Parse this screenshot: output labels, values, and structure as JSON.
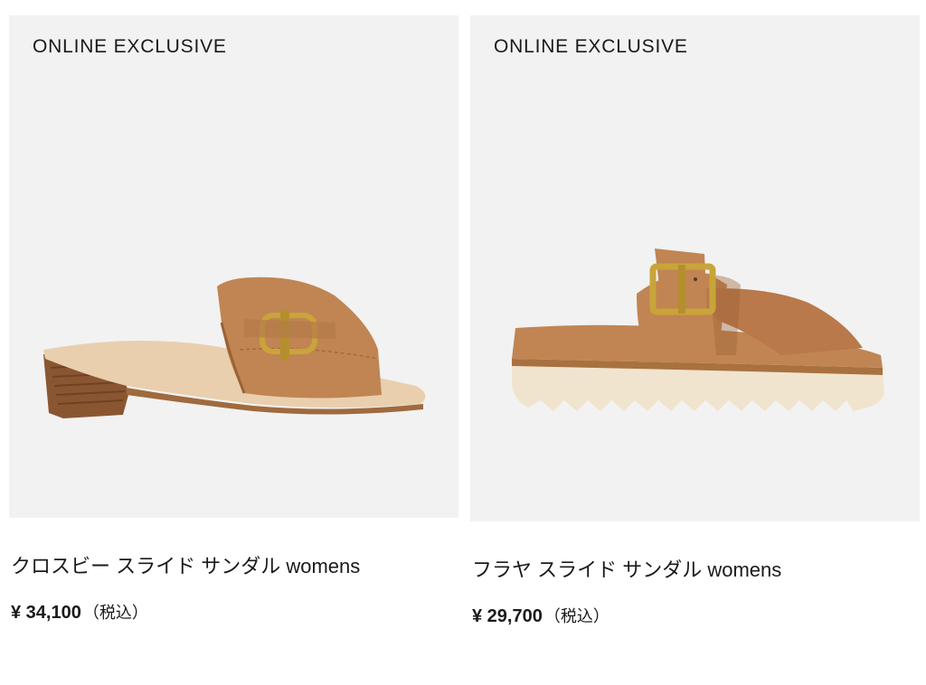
{
  "products": [
    {
      "badge": "ONLINE EXCLUSIVE",
      "name": "クロスビー スライド  サンダル womens",
      "price": "¥ 34,100",
      "tax_note": "（税込）",
      "image_icon": "heeled-slide-sandal"
    },
    {
      "badge": "ONLINE EXCLUSIVE",
      "name": "フラヤ スライド サンダル womens",
      "price": "¥ 29,700",
      "tax_note": "（税込）",
      "image_icon": "platform-cross-strap-sandal"
    }
  ],
  "colors": {
    "image_bg": "#f2f2f2",
    "leather": "#c08553",
    "leather_dark": "#9b6237",
    "gold": "#c9a43a",
    "sole_cream": "#f1e4cf"
  }
}
